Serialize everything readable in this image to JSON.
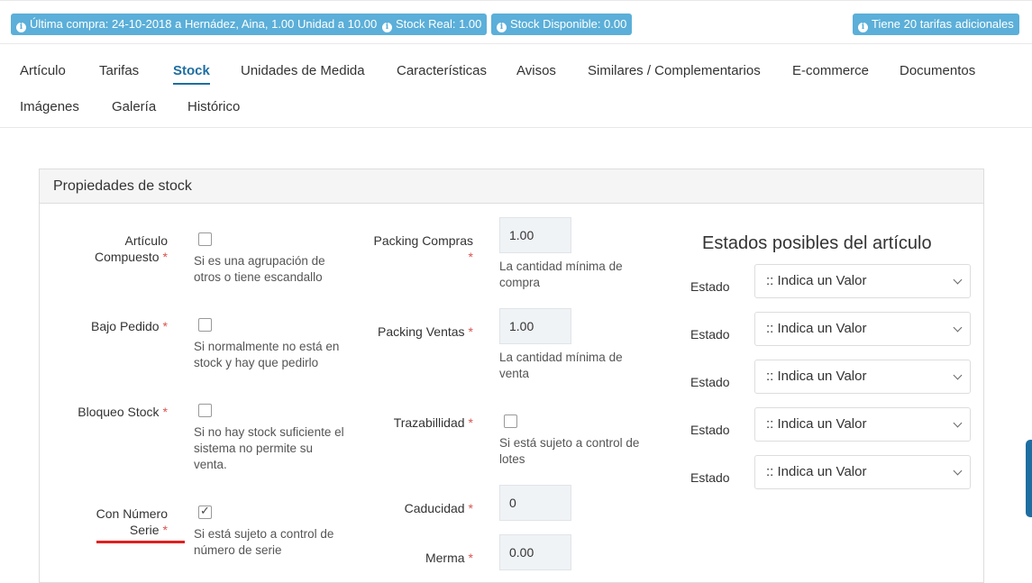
{
  "badges": {
    "ultima_compra": "Última compra: 24-10-2018 a Hernádez, Aina, 1.00 Unidad a 10.00€",
    "stock_real": "Stock Real: 1.00",
    "stock_disponible": "Stock Disponible: 0.00",
    "tarifas": "Tiene 20 tarifas adicionales",
    "color": "#5bafd9"
  },
  "tabs": [
    "Artículo",
    "Tarifas",
    "Stock",
    "Unidades de Medida",
    "Características",
    "Avisos",
    "Similares / Complementarios",
    "E-commerce",
    "Documentos",
    "Imágenes",
    "Galería",
    "Histórico"
  ],
  "active_tab": "Stock",
  "panel": {
    "title": "Propiedades de stock",
    "required_mark": "*",
    "left": {
      "compuesto_label_1": "Artículo",
      "compuesto_label_2": "Compuesto",
      "compuesto_help_1": "Si es una agrupación de",
      "compuesto_help_2": "otros o tiene escandallo",
      "bajo_pedido_label": "Bajo Pedido",
      "bajo_pedido_help_1": "Si normalmente no está en",
      "bajo_pedido_help_2": "stock y hay que pedirlo",
      "bloqueo_label": "Bloqueo Stock",
      "bloqueo_help_1": "Si no hay stock suficiente el",
      "bloqueo_help_2": "sistema no permite su",
      "bloqueo_help_3": "venta.",
      "serie_label_1": "Con Número",
      "serie_label_2": "Serie",
      "serie_help_1": "Si está sujeto a control de",
      "serie_help_2": "número de serie"
    },
    "middle": {
      "packing_compras_label": "Packing Compras",
      "packing_compras_value": "1.00",
      "packing_compras_help_1": "La cantidad mínima de",
      "packing_compras_help_2": "compra",
      "packing_ventas_label": "Packing Ventas",
      "packing_ventas_value": "1.00",
      "packing_ventas_help_1": "La cantidad mínima de",
      "packing_ventas_help_2": "venta",
      "trazabilidad_label": "Trazabillidad",
      "trazabilidad_help_1": "Si está sujeto a control de",
      "trazabilidad_help_2": "lotes",
      "caducidad_label": "Caducidad",
      "caducidad_value": "0",
      "merma_label": "Merma",
      "merma_value": "0.00"
    },
    "estados": {
      "title": "Estados posibles del artículo",
      "label": "Estado",
      "placeholder": ":: Indica un Valor"
    }
  },
  "checkboxes": {
    "compuesto": false,
    "bajo_pedido": false,
    "bloqueo": false,
    "trazabilidad": false,
    "serie": true
  }
}
